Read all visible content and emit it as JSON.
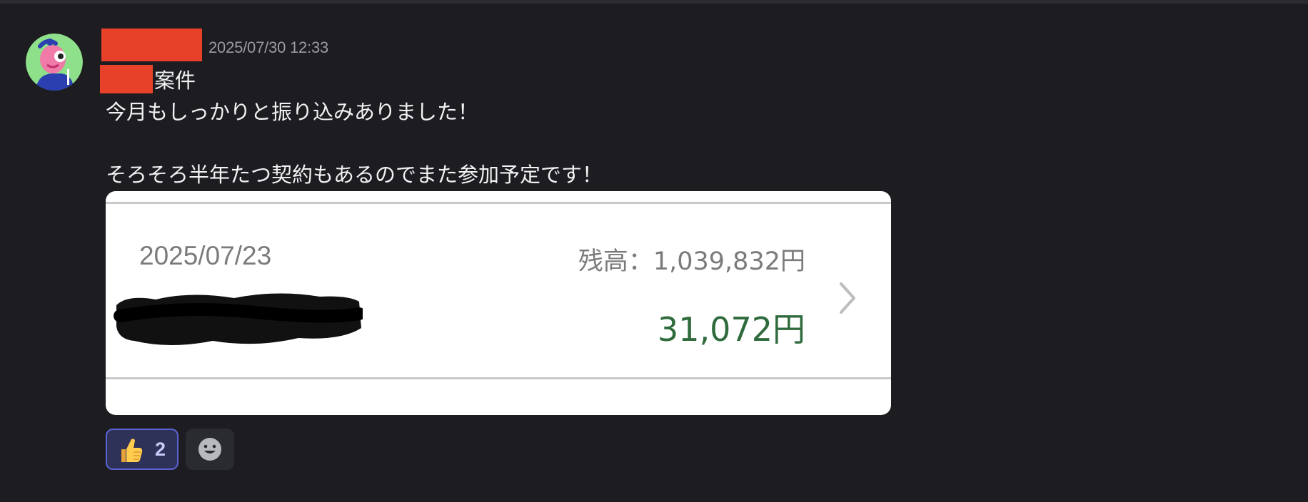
{
  "message": {
    "timestamp": "2025/07/30 12:33",
    "lines": [
      "案件",
      "今月もしっかりと振り込みありました！",
      "そろそろ半年たつ契約もあるのでまた参加予定です！"
    ]
  },
  "attachment": {
    "date": "2025/07/23",
    "balance": "残高：1,039,832円",
    "amount": "31,072円",
    "colors": {
      "amount": "#2f6b3c",
      "muted": "#7b7b7d"
    }
  },
  "reactions": [
    {
      "emoji_icon": "thumbs-up-icon",
      "count": "2"
    }
  ],
  "add_reaction": {
    "icon": "smiley-icon"
  },
  "colors": {
    "background": "#1c1c21",
    "redaction": "#e8412a",
    "reaction_border": "#5b63d3"
  }
}
